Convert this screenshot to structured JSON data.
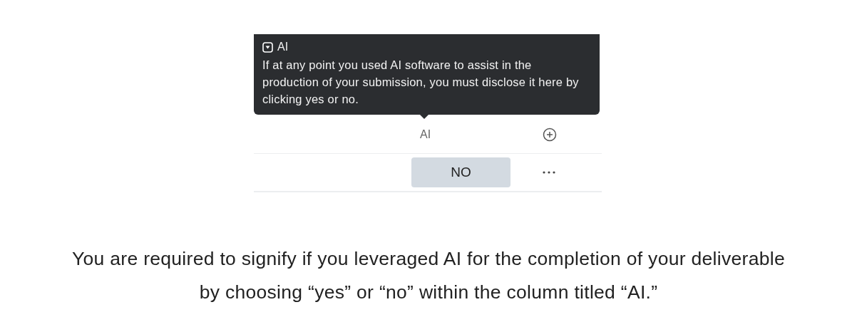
{
  "tooltip": {
    "title": "AI",
    "text": "If at any point you used AI software to assist in the production of your submission, you must disclose it here by clicking yes or no."
  },
  "table": {
    "columns": [
      {
        "label": "AI"
      }
    ],
    "rows": [
      {
        "value": "NO"
      }
    ]
  },
  "caption": "You are required to signify if you leveraged AI for the completion of your deliverable by choosing “yes” or “no” within the column titled “AI.”"
}
